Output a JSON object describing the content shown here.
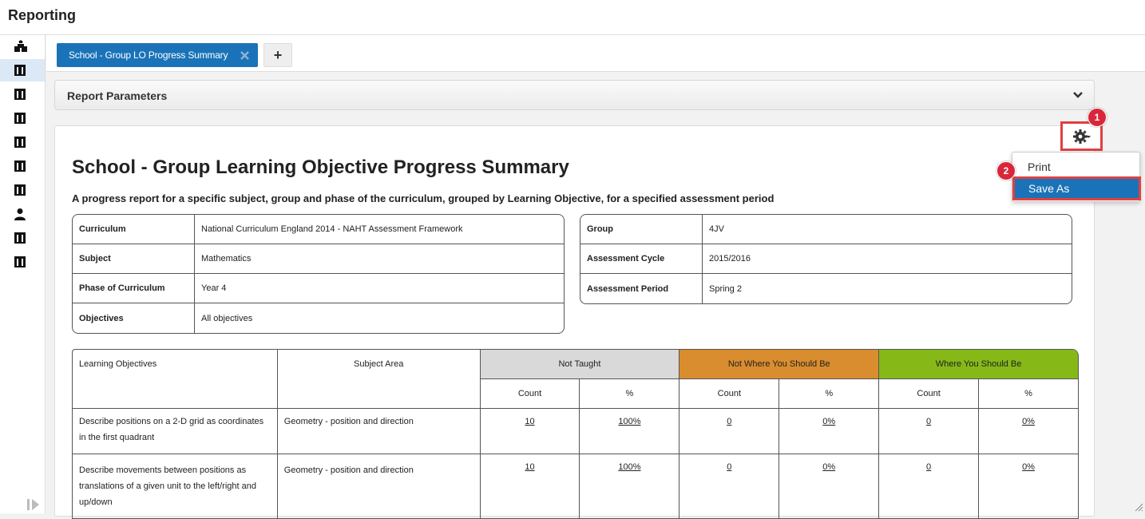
{
  "app": {
    "title": "Reporting"
  },
  "sidebar": {
    "items": [
      {
        "icon": "school-icon"
      },
      {
        "icon": "building-icon",
        "active": true
      },
      {
        "icon": "building-icon"
      },
      {
        "icon": "building-icon"
      },
      {
        "icon": "building-icon"
      },
      {
        "icon": "building-icon"
      },
      {
        "icon": "building-icon"
      },
      {
        "icon": "person-icon"
      },
      {
        "icon": "building-icon"
      },
      {
        "icon": "building-icon"
      }
    ],
    "expand_icon": "expand-sidebar-icon"
  },
  "tabs": {
    "active_label": "School - Group LO Progress Summary",
    "add_label": "+"
  },
  "params": {
    "title": "Report Parameters"
  },
  "menu": {
    "items": [
      "Print",
      "Save As"
    ],
    "badge1": "1",
    "badge2": "2"
  },
  "report": {
    "title": "School - Group Learning Objective Progress Summary",
    "description": "A progress report for a specific subject, group and phase of the curriculum, grouped by Learning Objective, for a specified assessment period",
    "left_params": [
      {
        "label": "Curriculum",
        "value": "National Curriculum England 2014 - NAHT Assessment Framework"
      },
      {
        "label": "Subject",
        "value": "Mathematics"
      },
      {
        "label": "Phase of Curriculum",
        "value": "Year 4"
      },
      {
        "label": "Objectives",
        "value": "All objectives"
      }
    ],
    "right_params": [
      {
        "label": "Group",
        "value": "4JV"
      },
      {
        "label": "Assessment Cycle",
        "value": "2015/2016"
      },
      {
        "label": "Assessment Period",
        "value": "Spring 2"
      }
    ],
    "table": {
      "headers": {
        "learning_objectives": "Learning Objectives",
        "subject_area": "Subject Area",
        "not_taught": "Not Taught",
        "not_where": "Not Where You Should Be",
        "where": "Where You Should Be",
        "count": "Count",
        "percent": "%"
      },
      "colors": {
        "not_taught": "#d9d9d9",
        "not_where": "#d98d2e",
        "where": "#86b918"
      },
      "rows": [
        {
          "objective": "Describe positions on a 2-D grid as coordinates in the first quadrant",
          "area": "Geometry - position and direction",
          "nt_count": "10",
          "nt_pct": "100%",
          "nw_count": "0",
          "nw_pct": "0%",
          "ws_count": "0",
          "ws_pct": "0%"
        },
        {
          "objective": "Describe movements between positions as translations of a given unit to the left/right and up/down",
          "area": "Geometry - position and direction",
          "nt_count": "10",
          "nt_pct": "100%",
          "nw_count": "0",
          "nw_pct": "0%",
          "ws_count": "0",
          "ws_pct": "0%"
        }
      ]
    }
  }
}
